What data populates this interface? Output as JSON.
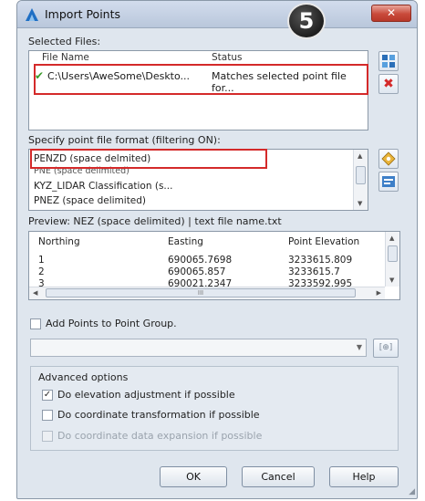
{
  "window": {
    "title": "Import Points",
    "step_number": "5",
    "close_glyph": "✕"
  },
  "selected_files": {
    "label": "Selected Files:",
    "columns": [
      "File Name",
      "Status"
    ],
    "rows": [
      {
        "file_name": "C:\\Users\\AweSome\\Deskto...",
        "status": "Matches selected point file for..."
      }
    ]
  },
  "format": {
    "label": "Specify point file format (filtering ON):",
    "items": [
      "PENZD (space delmited)",
      "PNE (space delimited)",
      "KYZ_LIDAR Classification (s...",
      "PNEZ (space delimited)"
    ],
    "selected": "PENZD (space delmited)"
  },
  "preview": {
    "label": "Preview: NEZ (space delimited) | text file name.txt",
    "columns": [
      "Northing",
      "Easting",
      "Point Elevation"
    ],
    "rows": [
      [
        "1",
        "690065.7698",
        "3233615.809"
      ],
      [
        "2",
        "690065.857",
        "3233615.7"
      ],
      [
        "3",
        "690021.2347",
        "3233592.995"
      ]
    ],
    "hscroll_thumb": "III"
  },
  "point_group": {
    "label": "Add Points to Point Group.",
    "checked": false,
    "dropdown_value": "",
    "add_glyph": "[⊕]"
  },
  "advanced": {
    "label": "Advanced options",
    "options": [
      {
        "label": "Do elevation adjustment if possible",
        "checked": true,
        "enabled": true
      },
      {
        "label": "Do coordinate transformation if possible",
        "checked": false,
        "enabled": true
      },
      {
        "label": "Do coordinate data expansion if possible",
        "checked": false,
        "enabled": false
      }
    ]
  },
  "buttons": {
    "ok": "OK",
    "cancel": "Cancel",
    "help": "Help"
  },
  "colors": {
    "highlight_box": "#d42a2a",
    "check_green": "#3a9a2a",
    "close_red": "#c94a3a"
  }
}
